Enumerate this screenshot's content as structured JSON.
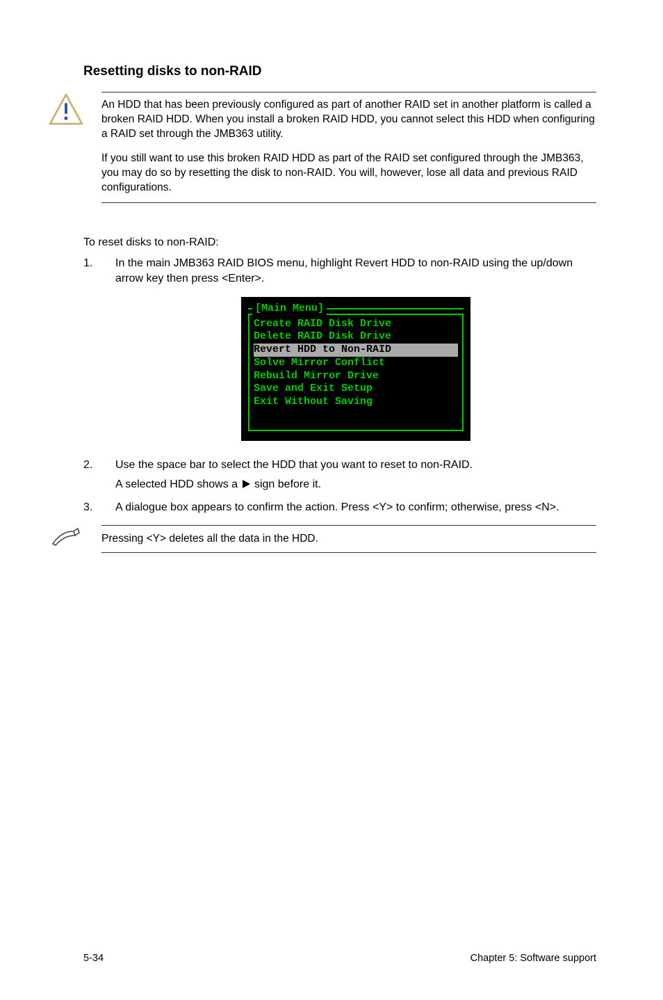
{
  "heading": "Resetting disks to non-RAID",
  "warning": {
    "para1": "An HDD that has been previously configured as part of another RAID set in another platform is called a broken RAID HDD. When you install a broken RAID HDD, you cannot select this HDD when configuring a RAID set through the JMB363 utility.",
    "para2": "If you still want to use this broken RAID HDD as part of the RAID set configured through the JMB363, you may do so by resetting the disk to non-RAID. You will, however, lose all data and previous RAID configurations."
  },
  "intro": "To reset disks to non-RAID:",
  "steps": {
    "s1": "In the main JMB363 RAID BIOS menu, highlight Revert HDD to non-RAID using the up/down arrow key then press <Enter>.",
    "s2": "Use the space bar to select the HDD that you want to reset to non-RAID.",
    "s2b_pre": "A selected HDD shows a ",
    "s2b_post": " sign before it.",
    "s3": "A dialogue box appears to confirm the action. Press <Y> to confirm; otherwise, press <N>."
  },
  "menu": {
    "title": "[Main Menu]",
    "items": [
      "Create RAID Disk Drive",
      "Delete RAID Disk Drive",
      "Revert HDD to Non-RAID",
      "Solve Mirror Conflict",
      "Rebuild Mirror Drive",
      "Save and Exit Setup",
      "Exit Without Saving"
    ],
    "selectedIndex": 2
  },
  "note": "Pressing <Y> deletes all the data in the HDD.",
  "footer": {
    "left": "5-34",
    "right": "Chapter 5: Software support"
  }
}
